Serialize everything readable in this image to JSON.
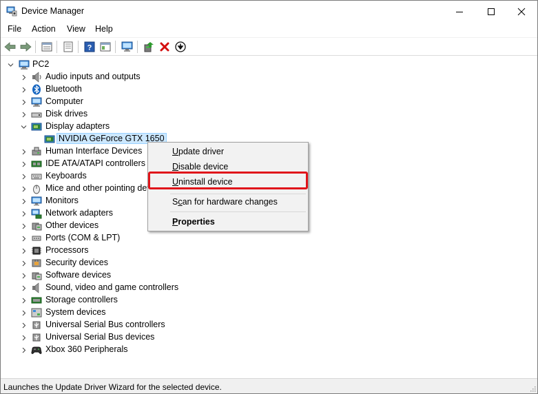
{
  "window": {
    "title": "Device Manager",
    "controls": [
      "minimize",
      "maximize",
      "close"
    ]
  },
  "menubar": {
    "items": [
      "File",
      "Action",
      "View",
      "Help"
    ]
  },
  "toolbar": {
    "buttons": [
      "back-icon",
      "forward-icon",
      "properties-list-icon",
      "show-hidden-icon",
      "help-icon",
      "action-pane-icon",
      "monitor-scan-icon",
      "update-driver-icon",
      "uninstall-icon",
      "download-icon"
    ]
  },
  "tree": {
    "root": "PC2",
    "categories": [
      {
        "label": "Audio inputs and outputs",
        "icon": "speaker-icon"
      },
      {
        "label": "Bluetooth",
        "icon": "bluetooth-icon"
      },
      {
        "label": "Computer",
        "icon": "computer-icon"
      },
      {
        "label": "Disk drives",
        "icon": "disk-drive-icon"
      },
      {
        "label": "Display adapters",
        "icon": "display-adapter-icon",
        "expanded": true,
        "children": [
          {
            "label": "NVIDIA GeForce GTX 1650",
            "icon": "display-adapter-icon",
            "selected": true
          }
        ]
      },
      {
        "label": "Human Interface Devices",
        "icon": "hid-icon"
      },
      {
        "label": "IDE ATA/ATAPI controllers",
        "icon": "ide-controller-icon"
      },
      {
        "label": "Keyboards",
        "icon": "keyboard-icon"
      },
      {
        "label": "Mice and other pointing devices",
        "icon": "mouse-icon"
      },
      {
        "label": "Monitors",
        "icon": "monitor-icon"
      },
      {
        "label": "Network adapters",
        "icon": "network-adapter-icon"
      },
      {
        "label": "Other devices",
        "icon": "other-devices-icon"
      },
      {
        "label": "Ports (COM & LPT)",
        "icon": "port-icon"
      },
      {
        "label": "Processors",
        "icon": "processor-icon"
      },
      {
        "label": "Security devices",
        "icon": "security-icon"
      },
      {
        "label": "Software devices",
        "icon": "software-device-icon"
      },
      {
        "label": "Sound, video and game controllers",
        "icon": "sound-icon"
      },
      {
        "label": "Storage controllers",
        "icon": "storage-controller-icon"
      },
      {
        "label": "System devices",
        "icon": "system-device-icon"
      },
      {
        "label": "Universal Serial Bus controllers",
        "icon": "usb-icon"
      },
      {
        "label": "Universal Serial Bus devices",
        "icon": "usb-icon"
      },
      {
        "label": "Xbox 360 Peripherals",
        "icon": "gamepad-icon"
      }
    ]
  },
  "context_menu": {
    "items": [
      {
        "label": "Update driver",
        "accel_index": 0
      },
      {
        "label": "Disable device",
        "accel_index": 0
      },
      {
        "label": "Uninstall device",
        "accel_index": 0,
        "highlighted_box": true
      },
      {
        "label": "Scan for hardware changes",
        "accel_index": 1
      },
      {
        "label": "Properties",
        "accel_index": 0,
        "bold": true
      }
    ]
  },
  "statusbar": {
    "text": "Launches the Update Driver Wizard for the selected device."
  },
  "colors": {
    "selection_bg": "#cce8ff",
    "selection_border": "#99d1ff",
    "highlight_red": "#e0141a",
    "menu_bg": "#f2f2f2"
  }
}
